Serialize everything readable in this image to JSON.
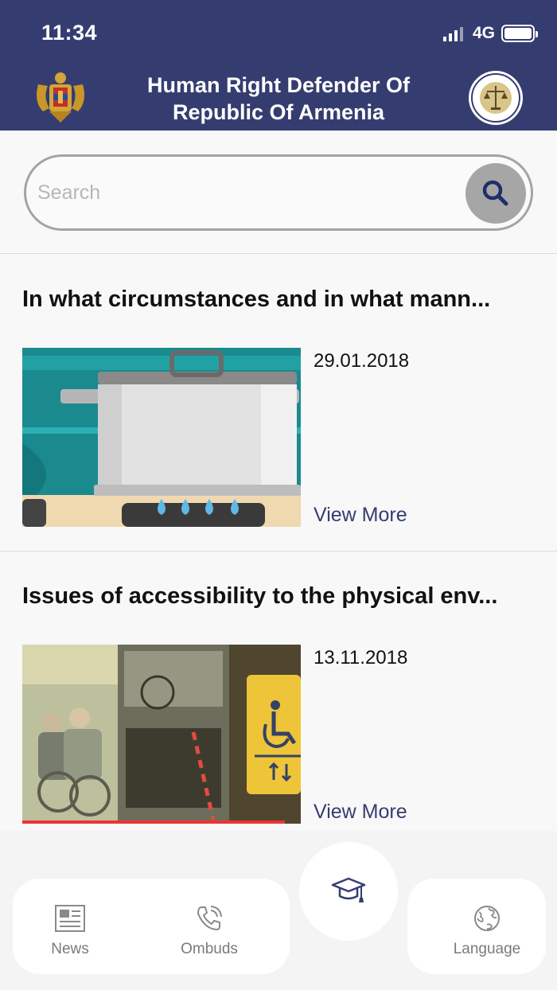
{
  "status_bar": {
    "time": "11:34",
    "network": "4G"
  },
  "header": {
    "title": "Human Right Defender Of Republic Of Armenia"
  },
  "search": {
    "placeholder": "Search"
  },
  "articles": [
    {
      "title": "In what circumstances and in what mann...",
      "date": "29.01.2018",
      "view_more": "View More"
    },
    {
      "title": "Issues of accessibility to the physical env...",
      "date": "13.11.2018",
      "view_more": "View More"
    }
  ],
  "bottom_nav": {
    "news": "News",
    "ombuds": "Ombuds",
    "language": "Language"
  },
  "colors": {
    "header_bg": "#353d70",
    "accent": "#353d70",
    "search_button": "#a6a6a6"
  }
}
